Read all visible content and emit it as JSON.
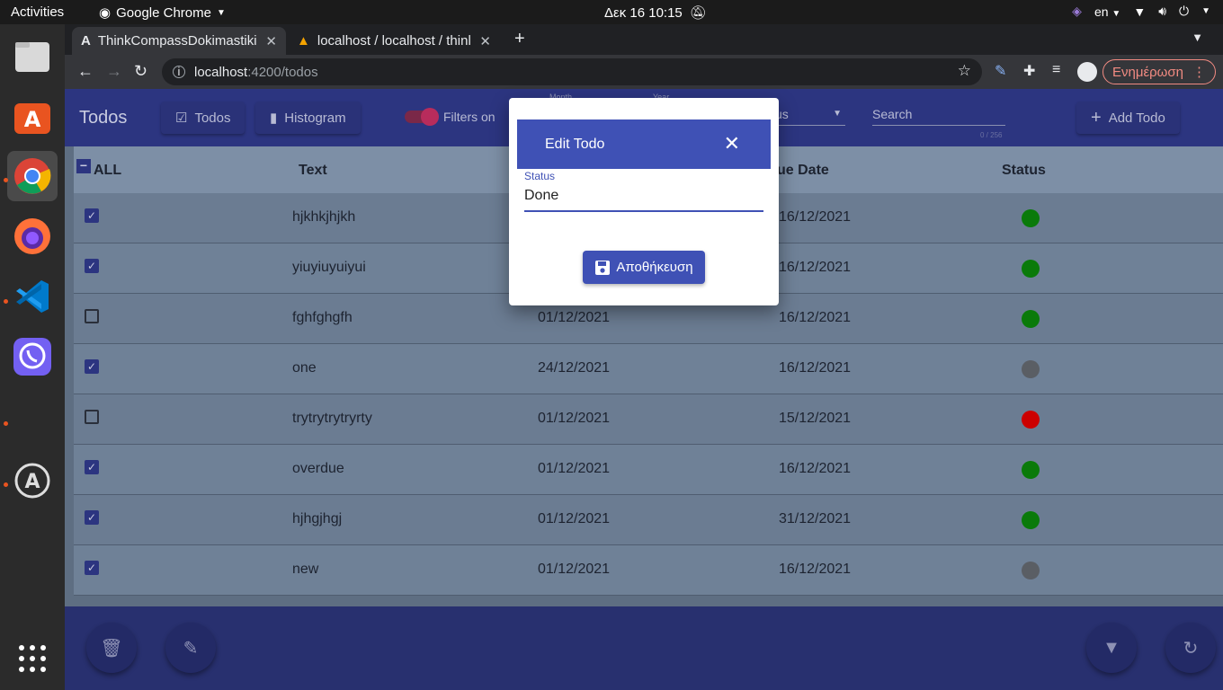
{
  "topbar": {
    "activities": "Activities",
    "app_name": "Google Chrome",
    "clock": "Δεκ 16  10:15",
    "lang": "en"
  },
  "browser": {
    "tabs": [
      {
        "label": "ThinkCompassDokimastiki",
        "icon": "angular-icon"
      },
      {
        "label": "localhost / localhost / thinl",
        "icon": "phpmyadmin-icon"
      }
    ],
    "url_host": "localhost",
    "url_path": ":4200/todos",
    "update_label": "Ενημέρωση"
  },
  "app": {
    "title": "Todos",
    "nav": {
      "todos": "Todos",
      "histogram": "Histogram"
    },
    "filters_label": "Filters on",
    "month_label": "Month",
    "year_label": "Year",
    "status_placeholder": "us",
    "search_placeholder": "Search",
    "search_counter": "0 / 256",
    "add_label": "Add Todo"
  },
  "table": {
    "headers": {
      "all": "ALL",
      "text": "Text",
      "due_date": "ue Date",
      "status": "Status"
    },
    "rows": [
      {
        "checked": true,
        "text": "hjkhkjhjkh",
        "created": "",
        "due": "16/12/2021",
        "status_color": "#0a7a0a"
      },
      {
        "checked": true,
        "text": "yiuyiuyuiyui",
        "created": "",
        "due": "16/12/2021",
        "status_color": "#0a7a0a"
      },
      {
        "checked": false,
        "text": "fghfghgfh",
        "created": "01/12/2021",
        "due": "16/12/2021",
        "status_color": "#0a7a0a"
      },
      {
        "checked": true,
        "text": "one",
        "created": "24/12/2021",
        "due": "16/12/2021",
        "status_color": "#5a5e64"
      },
      {
        "checked": false,
        "text": "trytrytrytryrty",
        "created": "01/12/2021",
        "due": "15/12/2021",
        "status_color": "#cc0000"
      },
      {
        "checked": true,
        "text": "overdue",
        "created": "01/12/2021",
        "due": "16/12/2021",
        "status_color": "#0a7a0a"
      },
      {
        "checked": true,
        "text": "hjhgjhgj",
        "created": "01/12/2021",
        "due": "31/12/2021",
        "status_color": "#0a7a0a"
      },
      {
        "checked": true,
        "text": "new",
        "created": "01/12/2021",
        "due": "16/12/2021",
        "status_color": "#5a5e64"
      }
    ]
  },
  "dialog": {
    "title": "Edit Todo",
    "field_label": "Status",
    "field_value": "Done",
    "save_label": "Αποθήκευση"
  }
}
